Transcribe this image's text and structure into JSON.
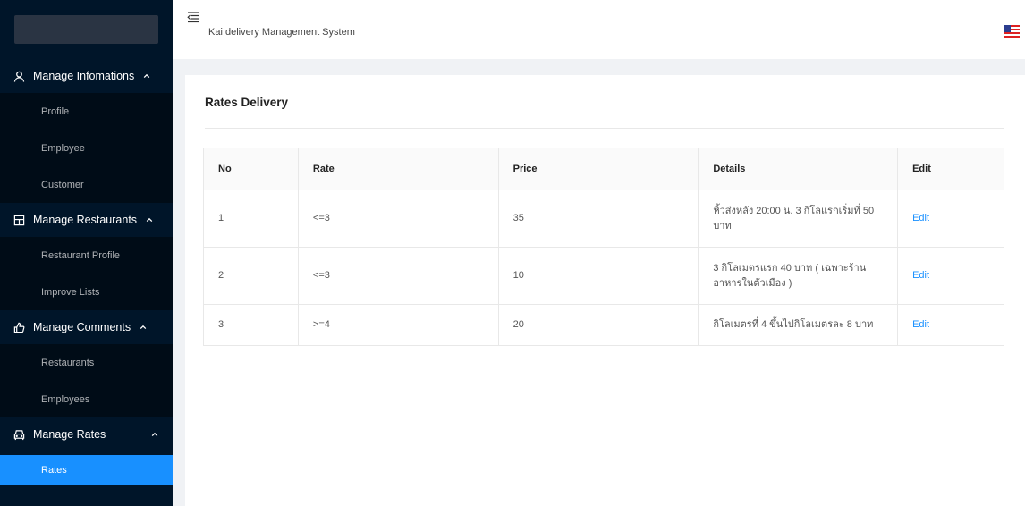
{
  "sidebar": {
    "groups": [
      {
        "title": "Manage Infomations",
        "icon": "user-icon",
        "items": [
          "Profile",
          "Employee",
          "Customer"
        ]
      },
      {
        "title": "Manage Restaurants",
        "icon": "shop-icon",
        "items": [
          "Restaurant Profile",
          "Improve Lists"
        ]
      },
      {
        "title": "Manage Comments",
        "icon": "like-icon",
        "items": [
          "Restaurants",
          "Employees"
        ]
      },
      {
        "title": "Manage Rates",
        "icon": "car-icon",
        "items": [
          "Rates"
        ]
      }
    ],
    "active_item": "Rates"
  },
  "header": {
    "title": "Kai delivery Management System",
    "menu_icon": "menu-fold-icon",
    "language_icon": "us-flag-icon"
  },
  "card": {
    "title": "Rates Delivery",
    "table": {
      "columns": [
        "No",
        "Rate",
        "Price",
        "Details",
        "Edit"
      ],
      "rows": [
        {
          "no": "1",
          "rate": "<=3",
          "price": "35",
          "details": "หิ้วส่งหลัง 20:00 น. 3 กิโลแรกเริ่มที่ 50 บาท",
          "edit": "Edit"
        },
        {
          "no": "2",
          "rate": "<=3",
          "price": "10",
          "details": "3 กิโลเมตรแรก 40 บาท ( เฉพาะร้านอาหารในตัวเมือง )",
          "edit": "Edit"
        },
        {
          "no": "3",
          "rate": ">=4",
          "price": "20",
          "details": "กิโลเมตรที่ 4 ขึ้นไปกิโลเมตรละ 8 บาท",
          "edit": "Edit"
        }
      ]
    }
  },
  "colors": {
    "sidebar_bg": "#001529",
    "submenu_bg": "#000c17",
    "accent": "#1890ff"
  }
}
